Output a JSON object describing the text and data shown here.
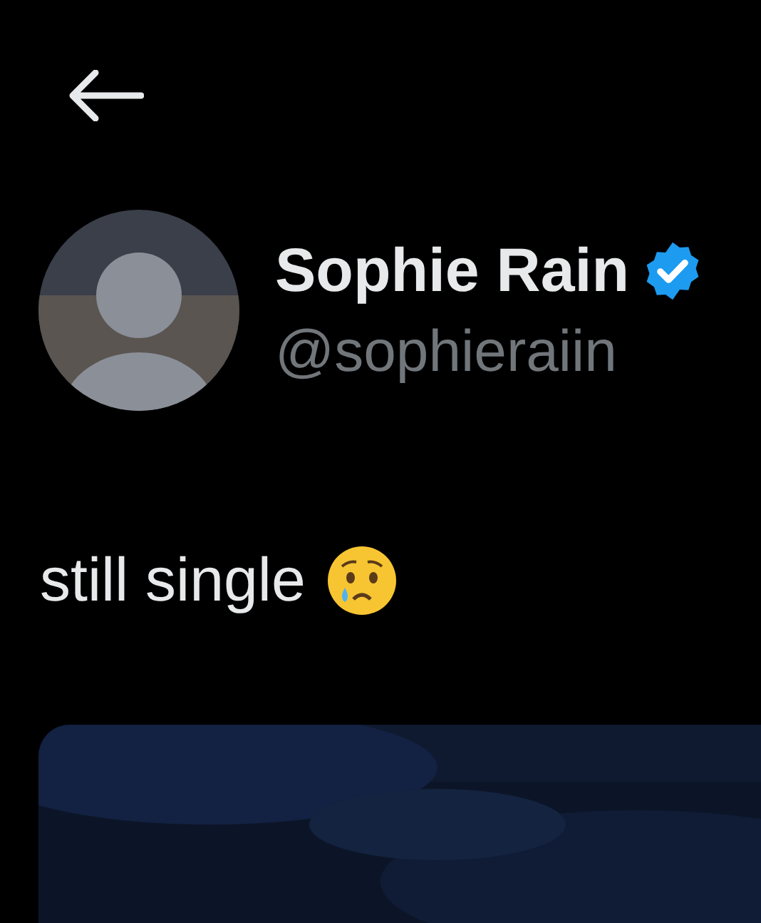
{
  "tweet": {
    "author": {
      "name": "Sophie Rain",
      "handle": "@sophieraiin",
      "verified": true
    },
    "text": "still single"
  }
}
